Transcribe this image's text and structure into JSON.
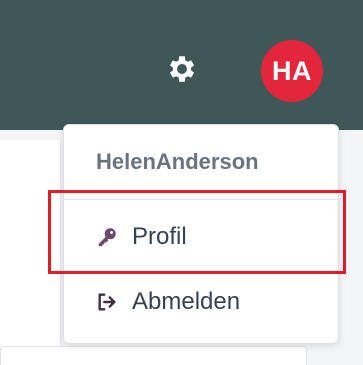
{
  "header": {
    "settings_icon": "gear-icon",
    "avatar_initials": "HA",
    "avatar_color": "#e3263c",
    "bar_color": "#3f5757"
  },
  "user_menu": {
    "username": "HelenAnderson",
    "items": [
      {
        "label": "Profil",
        "icon": "key-icon"
      },
      {
        "label": "Abmelden",
        "icon": "sign-out-icon"
      }
    ]
  },
  "highlight_color": "#e11d2a"
}
